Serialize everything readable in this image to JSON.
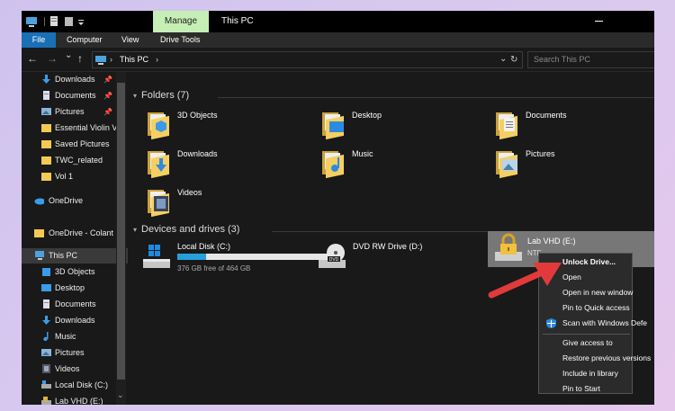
{
  "window": {
    "manage_tab": "Manage",
    "title": "This PC"
  },
  "ribbon": {
    "tabs": [
      "File",
      "Computer",
      "View",
      "Drive Tools"
    ]
  },
  "nav": {
    "back": "←",
    "forward": "→",
    "recent": "⌄",
    "up": "↑",
    "breadcrumb_sep": "›",
    "address": "This PC",
    "address_chev": "›",
    "dropdown": "⌄",
    "refresh": "↻",
    "search_placeholder": "Search This PC"
  },
  "sidebar": {
    "pin_glyph": "📌",
    "items": [
      {
        "label": "Downloads",
        "pinned": true
      },
      {
        "label": "Documents",
        "pinned": true
      },
      {
        "label": "Pictures",
        "pinned": true
      },
      {
        "label": "Essential Violin V"
      },
      {
        "label": "Saved Pictures"
      },
      {
        "label": "TWC_related"
      },
      {
        "label": "Vol 1"
      },
      {
        "label": "OneDrive"
      },
      {
        "label": "OneDrive - Colant"
      },
      {
        "label": "This PC"
      },
      {
        "label": "3D Objects"
      },
      {
        "label": "Desktop"
      },
      {
        "label": "Documents"
      },
      {
        "label": "Downloads"
      },
      {
        "label": "Music"
      },
      {
        "label": "Pictures"
      },
      {
        "label": "Videos"
      },
      {
        "label": "Local Disk (C:)"
      },
      {
        "label": "Lab VHD (E:)"
      }
    ],
    "scroll_down": "⌄"
  },
  "folders": {
    "header": "Folders (7)",
    "items": [
      "3D Objects",
      "Desktop",
      "Documents",
      "Downloads",
      "Music",
      "Pictures",
      "Videos"
    ]
  },
  "devices": {
    "header": "Devices and drives (3)",
    "local_disk": {
      "name": "Local Disk (C:)",
      "free": "376 GB free of 464 GB",
      "used_fraction": 0.19
    },
    "dvd": {
      "name": "DVD RW Drive (D:)",
      "label": "DVD"
    },
    "lab_vhd": {
      "name": "Lab VHD (E:)",
      "fs": "NTF"
    }
  },
  "context_menu": {
    "items": [
      "Unlock Drive...",
      "Open",
      "Open in new window",
      "Pin to Quick access",
      "Scan with Windows Defe",
      "Give access to",
      "Restore previous versions",
      "Include in library",
      "Pin to Start"
    ]
  },
  "colors": {
    "accent": "#1a6fb5",
    "manage": "#c5efb4",
    "arrow": "#e23a3a",
    "progress": "#26a0da"
  }
}
